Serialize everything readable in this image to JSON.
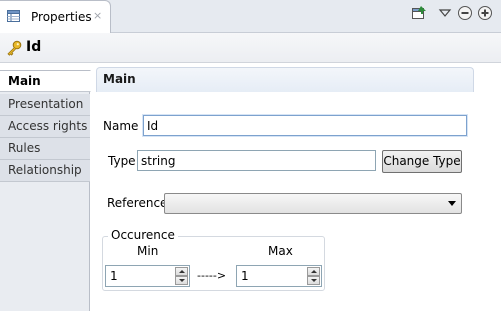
{
  "view": {
    "tab_label": "Properties",
    "tab_close": "×",
    "title": "Id"
  },
  "side_tabs": [
    "Main",
    "Presentation",
    "Access rights",
    "Rules",
    "Relationship"
  ],
  "section": {
    "title": "Main"
  },
  "form": {
    "name_label": "Name",
    "name_value": "Id",
    "type_label": "Type",
    "type_value": "string",
    "change_type_label": "Change Type",
    "reference_label": "Reference",
    "reference_value": ""
  },
  "occurence": {
    "legend": "Occurence",
    "min_label": "Min",
    "max_label": "Max",
    "min_value": "1",
    "max_value": "1",
    "arrow_text": "----->"
  },
  "colors": {
    "accent": "#7da2ce",
    "key_icon": "#d4a017"
  },
  "icons": {
    "tab": "properties-table-icon",
    "title": "key-icon",
    "toolbar": [
      "pin-to-selection-icon",
      "view-menu-icon",
      "minimize-icon",
      "maximize-icon"
    ]
  }
}
